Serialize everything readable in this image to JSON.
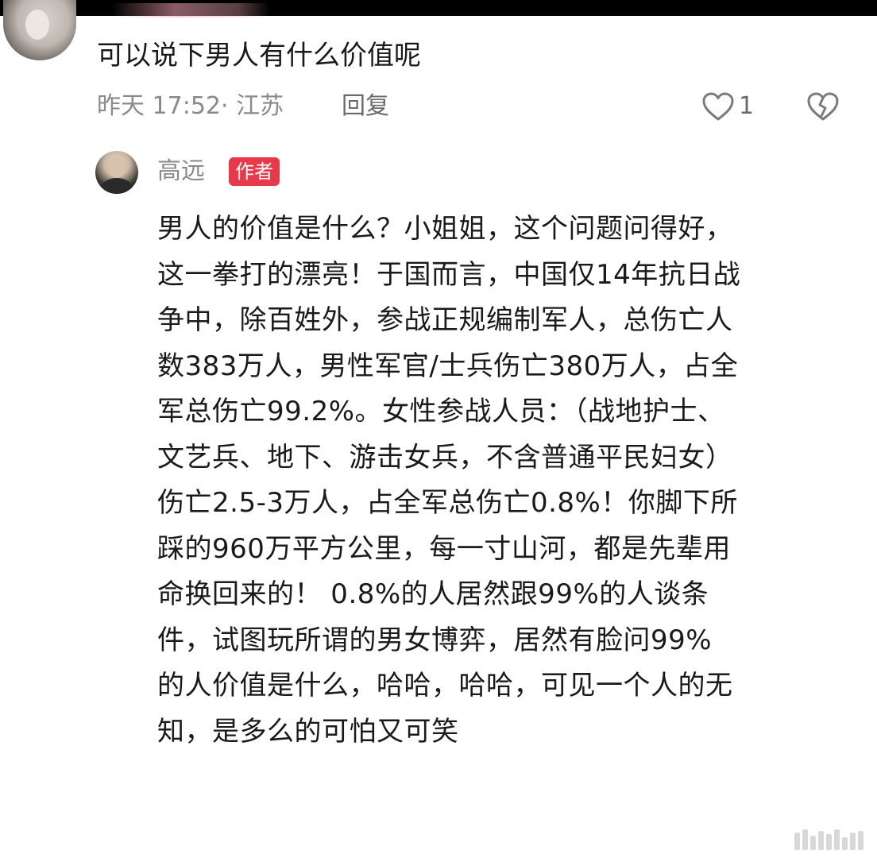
{
  "comment": {
    "text": "可以说下男人有什么价值呢",
    "meta": "昨天 17:52· 江苏",
    "reply_label": "回复",
    "like_count": "1",
    "icons": {
      "like": "heart-outline-icon",
      "dislike": "broken-heart-icon"
    }
  },
  "reply": {
    "author_name": "高远",
    "author_badge": "作者",
    "badge_color": "#e8394a",
    "lines": [
      "男人的价值是什么？小姐姐，这个问题问得好，",
      "这一拳打的漂亮！于国而言，中国仅14年抗日战",
      "争中，除百姓外，参战正规编制军人，总伤亡人",
      "数383万人，男性军官/士兵伤亡380万人，占全",
      "军总伤亡99.2%。女性参战人员：（战地护士、",
      "文艺兵、地下、游击女兵，不含普通平民妇女）",
      "伤亡2.5-3万人，占全军总伤亡0.8%！你脚下所",
      "踩的960万平方公里，每一寸山河，都是先辈用",
      "命换回来的！ 0.8%的人居然跟99%的人谈条",
      "件，试图玩所谓的男女博弈，居然有脸问99%",
      "的人价值是什么，哈哈，哈哈，可见一个人的无",
      "知，是多么的可怕又可笑"
    ]
  }
}
